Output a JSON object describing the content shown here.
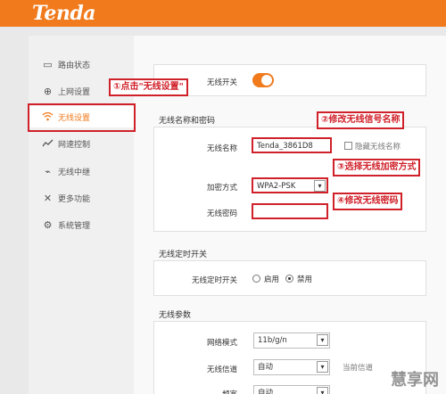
{
  "app": {
    "logo": "Tenda"
  },
  "sidebar": {
    "items": [
      {
        "label": "路由状态",
        "icon": "router-icon"
      },
      {
        "label": "上网设置",
        "icon": "globe-icon"
      },
      {
        "label": "无线设置",
        "icon": "wifi-icon",
        "active": true
      },
      {
        "label": "网速控制",
        "icon": "speed-chart-icon"
      },
      {
        "label": "无线中继",
        "icon": "antenna-icon"
      },
      {
        "label": "更多功能",
        "icon": "tools-icon"
      },
      {
        "label": "系统管理",
        "icon": "gear-icon"
      }
    ]
  },
  "wireless_switch": {
    "label": "无线开关",
    "on": true
  },
  "name_password_section": {
    "title": "无线名称和密码",
    "ssid_label": "无线名称",
    "ssid_value": "Tenda_3861D8",
    "hide_ssid_label": "隐藏无线名称",
    "encryption_label": "加密方式",
    "encryption_value": "WPA2-PSK",
    "password_label": "无线密码",
    "password_value": ""
  },
  "schedule_section": {
    "title": "无线定时开关",
    "row_label": "无线定时开关",
    "enable_label": "启用",
    "disable_label": "禁用",
    "selected": "禁用"
  },
  "params_section": {
    "title": "无线参数",
    "mode_label": "网络模式",
    "mode_value": "11b/g/n",
    "channel_label": "无线信道",
    "channel_value": "自动",
    "current_channel_label": "当前信道",
    "bandwidth_label": "频宽",
    "bandwidth_value": "自动"
  },
  "callouts": {
    "step1": "①点击\"无线设置\"",
    "step2": "②修改无线信号名称",
    "step3": "③选择无线加密方式",
    "step4": "④修改无线密码"
  },
  "watermark": "慧享网",
  "colors": {
    "brand": "#f07a1c",
    "annotation": "#d0212a"
  }
}
